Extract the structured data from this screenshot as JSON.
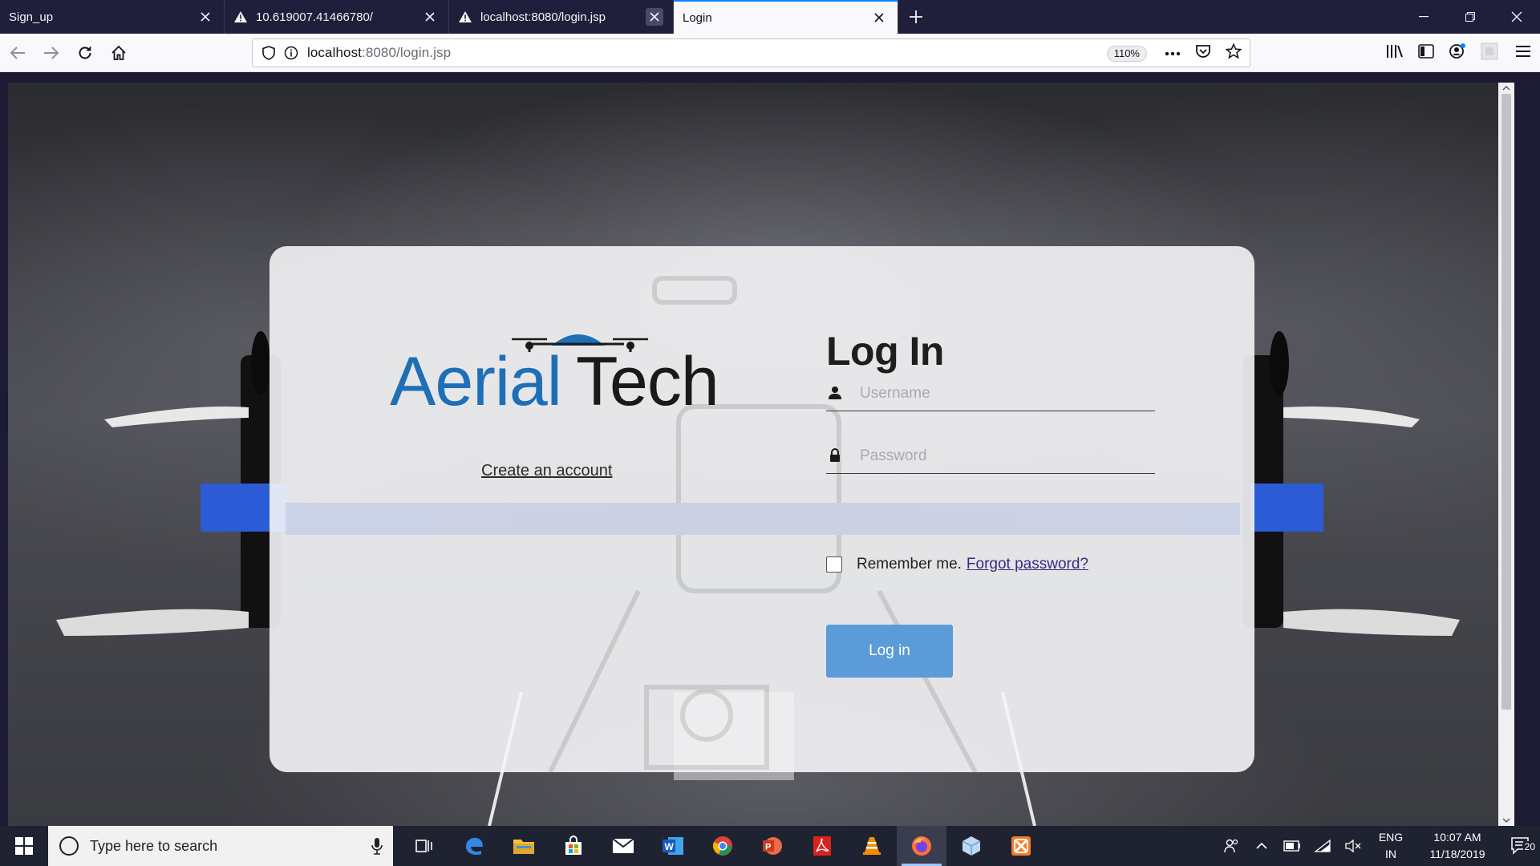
{
  "browser": {
    "tabs": [
      {
        "title": "Sign_up",
        "warning": false,
        "active": false
      },
      {
        "title": "10.619007.41466780/",
        "warning": true,
        "active": false
      },
      {
        "title": "localhost:8080/login.jsp",
        "warning": true,
        "active": false
      },
      {
        "title": "Login",
        "warning": false,
        "active": true
      }
    ],
    "url_host": "localhost",
    "url_rest": ":8080/login.jsp",
    "zoom": "110%"
  },
  "page": {
    "logo_text": "AerialTech",
    "create_account": "Create an account",
    "title": "Log In",
    "username_placeholder": "Username",
    "password_placeholder": "Password",
    "remember_label": "Remember me.",
    "forgot_label": "Forgot password?",
    "login_button": "Log in"
  },
  "taskbar": {
    "search_placeholder": "Type here to search",
    "apps": [
      "task-view",
      "edge",
      "file-explorer",
      "store",
      "mail",
      "word",
      "chrome",
      "powerpoint",
      "acrobat",
      "vlc",
      "firefox",
      "virtualbox",
      "xampp"
    ],
    "active_app": "firefox",
    "lang_line1": "ENG",
    "lang_line2": "IN",
    "time": "10:07 AM",
    "date": "11/18/2019",
    "notification_count": "20"
  },
  "colors": {
    "tabstrip": "#1f1e3b",
    "accent": "#0a84ff",
    "login_button": "#5b9bd8",
    "logo_blue": "#1f6fb7",
    "link_purple": "#3b2a80"
  }
}
